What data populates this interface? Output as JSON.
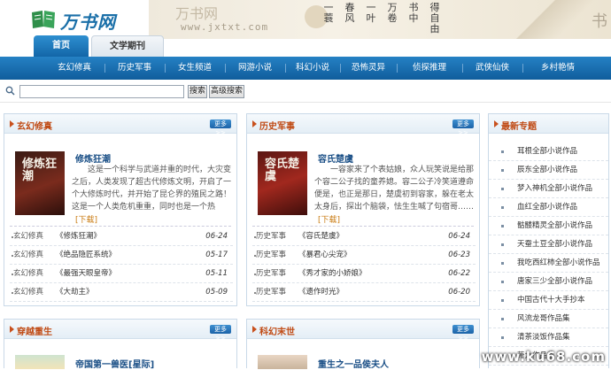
{
  "logo": {
    "text": "万书网"
  },
  "banner": {
    "watermark": "万书网",
    "url": "www.jxtxt.com",
    "poem_columns": [
      "一蓑",
      "春风",
      "一叶",
      "万卷",
      "书中",
      "得自由"
    ],
    "tail": "书"
  },
  "tabs": [
    {
      "label": "首页",
      "active": true
    },
    {
      "label": "文学期刊",
      "active": false
    }
  ],
  "nav": [
    "玄幻修真",
    "历史军事",
    "女生频道",
    "网游小说",
    "科幻小说",
    "恐怖灵异",
    "侦探推理",
    "武侠仙侠",
    "乡村艳情"
  ],
  "search": {
    "value": "",
    "search_label": "搜索",
    "advanced_label": "高级搜索"
  },
  "panels": {
    "xuanhuan": {
      "title": "玄幻修真",
      "more": "更多>>",
      "featured": {
        "cover_title": "修炼狂潮",
        "title": "修炼狂潮",
        "desc": "这是一个科学与武道并重的时代，大灾变之后，人类发现了超古代修炼文明，开启了一个大修炼时代，并开始了昆仑界的殖民之路！这是一个人类危机重重，同时也是一个热血……",
        "download": "[下载]"
      },
      "items": [
        {
          "cat": "玄幻修真",
          "name": "《修炼狂潮》",
          "date": "06-24"
        },
        {
          "cat": "玄幻修真",
          "name": "《绝品隐匠系统》",
          "date": "05-17"
        },
        {
          "cat": "玄幻修真",
          "name": "《最强天眼皇帝》",
          "date": "05-11"
        },
        {
          "cat": "玄幻修真",
          "name": "《大劫主》",
          "date": "05-09"
        }
      ]
    },
    "lishi": {
      "title": "历史军事",
      "more": "更多>>",
      "featured": {
        "cover_title": "容氏楚虞",
        "title": "容氏楚虞",
        "desc": "一容家来了个表姑娘，众人玩笑说是给那个容二公子找的童养媳。容二公子冷笑道遵命便是，也正是那日，楚虞初到容家，躲在老太太身后，探出个脑袋，怯生生喊了句宿哥……",
        "download": "[下载]"
      },
      "items": [
        {
          "cat": "历史军事",
          "name": "《容氏楚虞》",
          "date": "06-24"
        },
        {
          "cat": "历史军事",
          "name": "《暴君心尖宠》",
          "date": "06-23"
        },
        {
          "cat": "历史军事",
          "name": "《秀才家的小娇娘》",
          "date": "06-22"
        },
        {
          "cat": "历史军事",
          "name": "《遗作时光》",
          "date": "06-20"
        }
      ]
    },
    "zhuanti": {
      "title": "最新专题",
      "items": [
        "耳根全部小说作品",
        "辰东全部小说作品",
        "梦入神机全部小说作品",
        "血红全部小说作品",
        "骷髅精灵全部小说作品",
        "天蚕土豆全部小说作品",
        "我吃西红柿全部小说作品",
        "唐家三少全部小说作品",
        "中国古代十大手抄本",
        "风流龙哥作品集",
        "清茶淡饭作品集",
        "萧九作品集"
      ]
    },
    "chuanyue": {
      "title": "穿越重生",
      "more": "更多>>",
      "featured_title": "帝国第一兽医[星际]"
    },
    "kehuan": {
      "title": "科幻末世",
      "more": "更多>>",
      "featured_title": "重生之一品侯夫人"
    }
  },
  "footer_watermark": "www.ku68.com"
}
